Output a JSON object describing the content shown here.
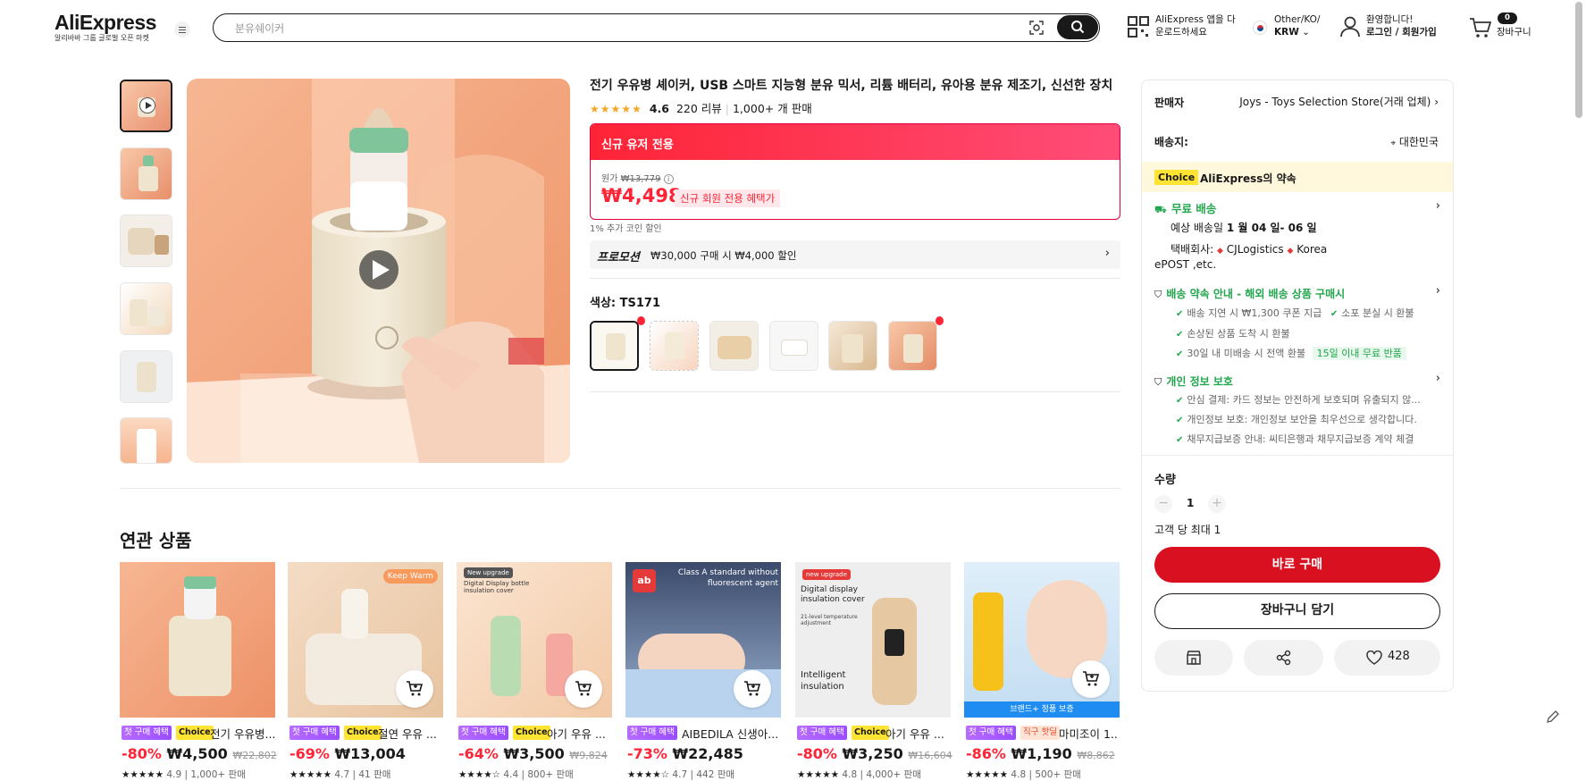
{
  "header": {
    "logo": "AliExpress",
    "logo_sub": "알리바바 그룹 글로벌 오픈 마켓",
    "search_placeholder": "분유쉐이커",
    "app_line1": "AliExpress 앱을 다",
    "app_line2": "운로드하세요",
    "region_line1": "Other/KO/",
    "region_line2": "KRW",
    "welcome": "환영합니다!",
    "login": "로그인 / 회원가입",
    "cart_count": "0",
    "cart_label": "장바구니"
  },
  "product": {
    "title": "전기 우유병 셰이커, USB 스마트 지능형 분유 믹서, 리튬 배터리, 유아용 분유 제조기, 신선한 장치",
    "rating": "4.6",
    "reviews": "220 리뷰",
    "sold": "1,000+ 개 판매",
    "promo_header": "신규 유저 전용",
    "orig_label": "원가",
    "orig_price": "₩13,779",
    "price": "₩4,498",
    "new_member_tag": "신규 회원 전용 혜택가",
    "coin_note": "1% 추가 코인 할인",
    "promotion_label": "프로모션",
    "promotion_text": "₩30,000 구매 시 ₩4,000 할인",
    "color_label": "색상: TS171"
  },
  "related": {
    "title": "연관 상품",
    "badge": "첫 구매 혜택",
    "choice": "Choice",
    "items": [
      {
        "name": "전기 우유병...",
        "discount": "-80%",
        "price": "₩4,500",
        "orig": "₩22,802",
        "rating": "4.9",
        "sold": "1,000+ 판매",
        "choice": true,
        "tag": ""
      },
      {
        "name": "절연 우유 ...",
        "discount": "-69%",
        "price": "₩13,004",
        "orig": "",
        "rating": "4.7",
        "sold": "41 판매",
        "choice": true,
        "tag": ""
      },
      {
        "name": "아기 우유 ...",
        "discount": "-64%",
        "price": "₩3,500",
        "orig": "₩9,824",
        "rating": "4.4",
        "sold": "800+ 판매",
        "choice": true,
        "tag": ""
      },
      {
        "name": "AIBEDILA 신생아...",
        "discount": "-73%",
        "price": "₩22,485",
        "orig": "",
        "rating": "4.7",
        "sold": "442 판매",
        "choice": false,
        "tag": ""
      },
      {
        "name": "아기 우유 ...",
        "discount": "-80%",
        "price": "₩3,250",
        "orig": "₩16,604",
        "rating": "4.8",
        "sold": "4,000+ 판매",
        "choice": true,
        "tag": ""
      },
      {
        "name": "마미조이 1...",
        "discount": "-86%",
        "price": "₩1,190",
        "orig": "₩8,862",
        "rating": "4.8",
        "sold": "500+ 판매",
        "choice": false,
        "tag": "직구 핫딜"
      }
    ],
    "img_texts": {
      "keep_warm": "Keep Warm",
      "new_upgrade": "New upgrade",
      "digital_display": "Digital Display bottle insulation cover",
      "class_a": "Class A standard without fluorescent agent",
      "ab": "ab",
      "new_upgrade2": "new upgrade",
      "digital_insul": "Digital display insulation cover",
      "temp_adj": "21-level temperature adjustment",
      "intelligent": "Intelligent insulation",
      "brand_plus": "브랜드+ 정품 보증"
    }
  },
  "sidebar": {
    "seller_label": "판매자",
    "seller_name": "Joys - Toys Selection Store(거래 업체)",
    "ship_label": "배송지:",
    "ship_to": "대한민국",
    "choice_tag": "Choice",
    "choice_promise": "AliExpress의 약속",
    "free_ship": "무료 배송",
    "eta_prefix": "예상 배송일",
    "eta": "1 월 04 일- 06 일",
    "carrier_label": "택배회사:",
    "carrier1": "CJLogistics",
    "carrier2": "Korea",
    "carrier3": "ePOST ,etc.",
    "guarantee_title": "배송 약속 안내 - 해외 배송 상품 구매시",
    "g1": "배송 지연 시 ₩1,300 쿠폰 지급",
    "g2": "소포 분실 시 환불",
    "g3": "손상된 상품 도착 시 환불",
    "g4": "30일 내 미배송 시 전액 환불",
    "g4_tag": "15일 이내 무료 반품",
    "privacy_title": "개인 정보 보호",
    "p1": "안심 결제: 카드 정보는 안전하게 보호되며 유출되지 않...",
    "p2": "개인정보 보호: 개인정보 보안을 최우선으로 생각합니다.",
    "p3": "채무지급보증 안내: 씨티은행과 채무지급보증 계약 체결",
    "qty_label": "수량",
    "qty": "1",
    "max_note": "고객 당 최대 1",
    "buy_now": "바로 구매",
    "add_cart": "장바구니 담기",
    "wish_count": "428"
  },
  "colors": {
    "brand_red": "#fe2436",
    "buy_red": "#d9101f",
    "green": "#22a64d",
    "choice_yellow": "#ffe433"
  }
}
